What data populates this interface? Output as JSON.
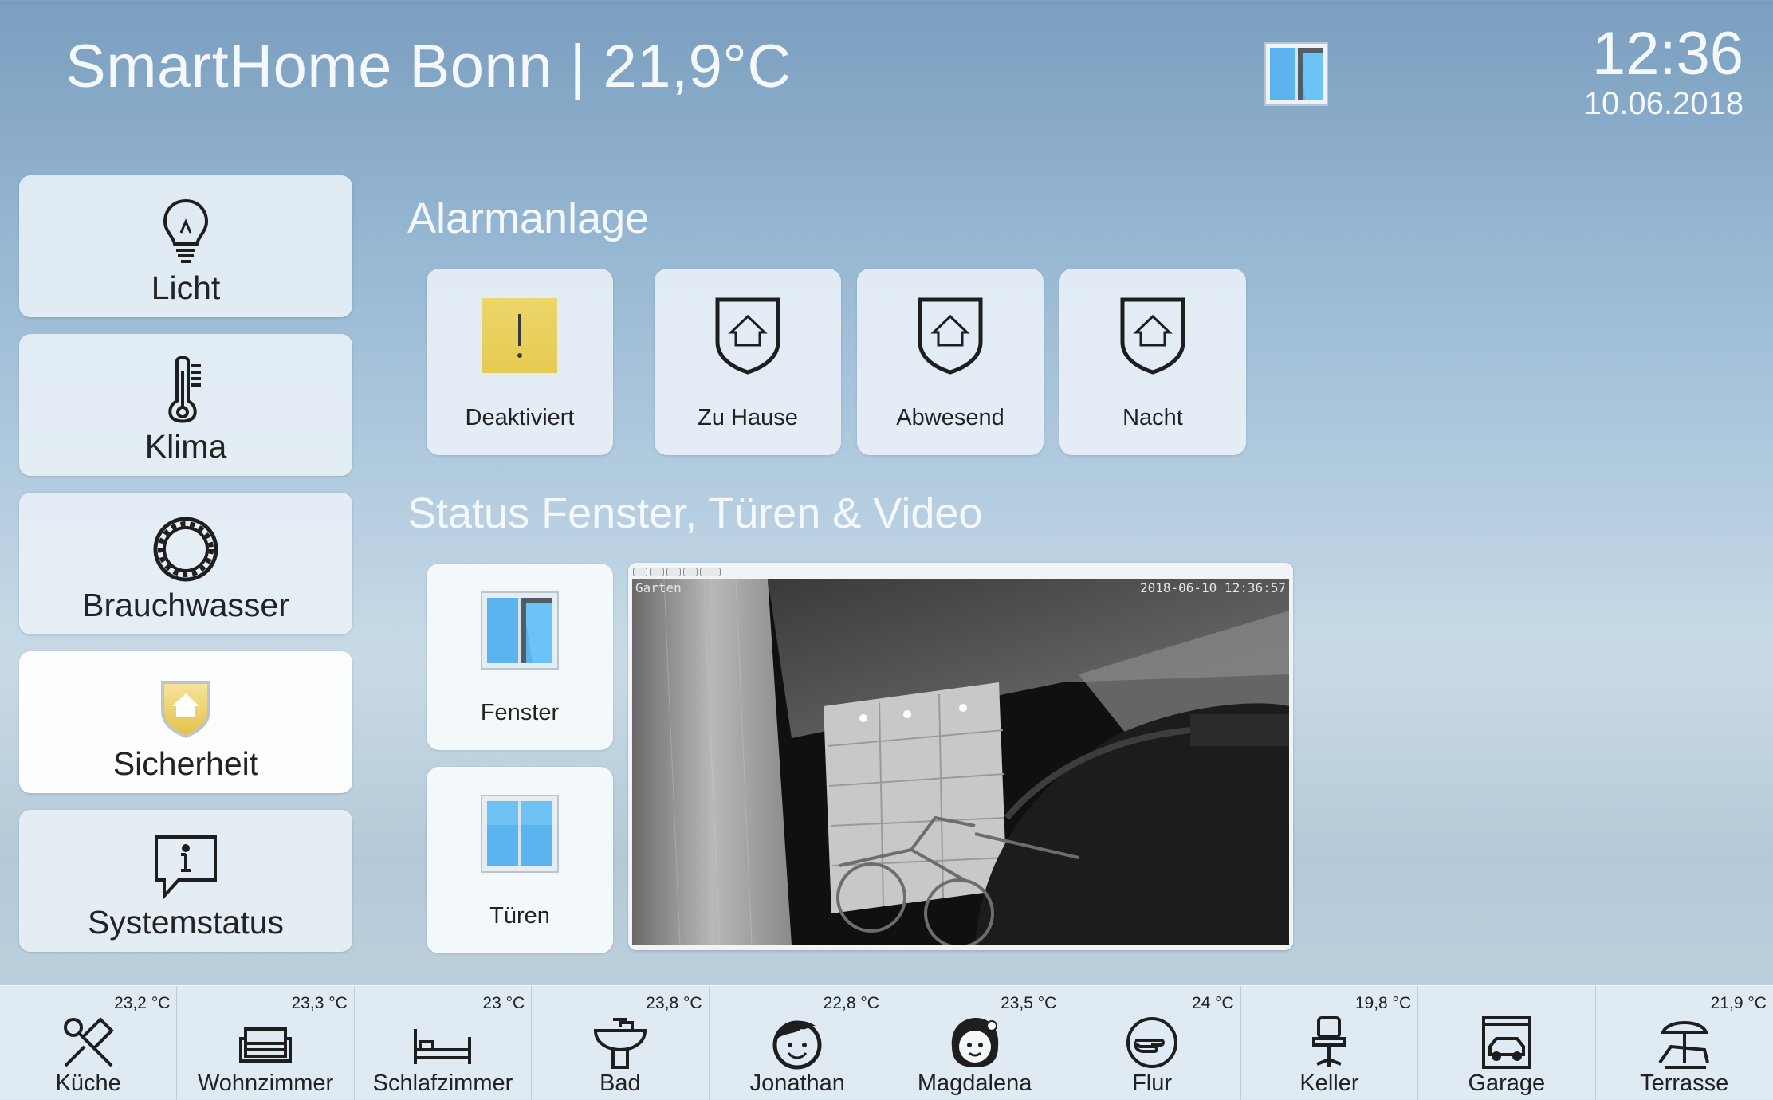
{
  "header": {
    "title": "SmartHome Bonn | 21,9°C",
    "window_icon": "window-icon",
    "time": "12:36",
    "date": "10.06.2018"
  },
  "nav": {
    "items": [
      {
        "label": "Licht",
        "icon": "light-bulb-icon"
      },
      {
        "label": "Klima",
        "icon": "thermometer-icon"
      },
      {
        "label": "Brauchwasser",
        "icon": "water-ring-icon"
      },
      {
        "label": "Sicherheit",
        "icon": "shield-house-icon",
        "active": true
      },
      {
        "label": "Systemstatus",
        "icon": "info-bubble-icon"
      }
    ]
  },
  "alarm": {
    "title": "Alarmanlage",
    "modes": [
      {
        "label": "Deaktiviert",
        "icon": "warning-icon"
      },
      {
        "label": "Zu Hause",
        "icon": "shield-home-icon"
      },
      {
        "label": "Abwesend",
        "icon": "shield-home-icon"
      },
      {
        "label": "Nacht",
        "icon": "shield-home-icon"
      }
    ]
  },
  "status": {
    "title": "Status Fenster, Türen & Video",
    "tiles": [
      {
        "label": "Fenster",
        "icon": "window-open-icon"
      },
      {
        "label": "Türen",
        "icon": "door-closed-icon"
      }
    ],
    "camera": {
      "name": "Garten",
      "timestamp": "2018-06-10 12:36:57"
    }
  },
  "rooms": [
    {
      "label": "Küche",
      "temp": "23,2 °C",
      "icon": "kitchen-utensils-icon"
    },
    {
      "label": "Wohnzimmer",
      "temp": "23,3 °C",
      "icon": "sofa-icon"
    },
    {
      "label": "Schlafzimmer",
      "temp": "23 °C",
      "icon": "bed-icon"
    },
    {
      "label": "Bad",
      "temp": "23,8 °C",
      "icon": "sink-icon"
    },
    {
      "label": "Jonathan",
      "temp": "22,8 °C",
      "icon": "boy-face-icon"
    },
    {
      "label": "Magdalena",
      "temp": "23,5 °C",
      "icon": "girl-face-icon"
    },
    {
      "label": "Flur",
      "temp": "24 °C",
      "icon": "hand-pointer-icon"
    },
    {
      "label": "Keller",
      "temp": "19,8 °C",
      "icon": "chair-icon"
    },
    {
      "label": "Garage",
      "temp": "",
      "icon": "garage-car-icon"
    },
    {
      "label": "Terrasse",
      "temp": "21,9 °C",
      "icon": "sunbed-umbrella-icon"
    }
  ],
  "colors": {
    "accent_yellow": "#e8cf55",
    "window_blue": "#5bb4ee",
    "icon_dark": "#1e1e1e"
  }
}
